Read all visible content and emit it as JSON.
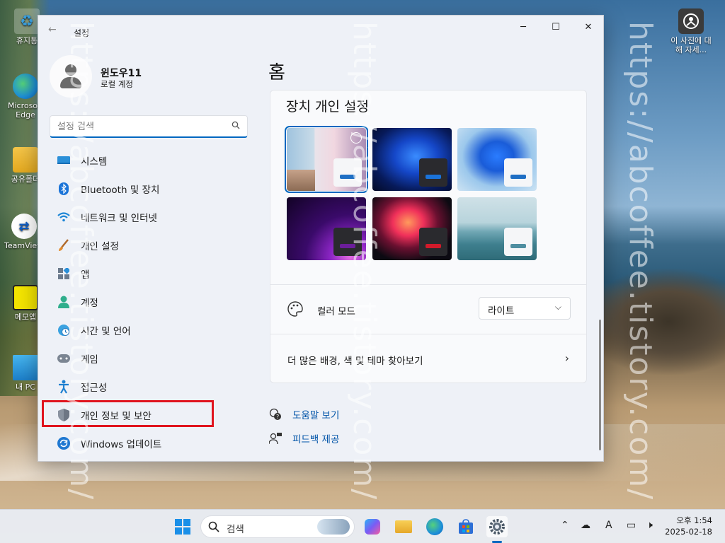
{
  "desktop": {
    "icons": [
      {
        "label": "휴지통"
      },
      {
        "label": "Microsoft Edge"
      },
      {
        "label": "공유폴더"
      },
      {
        "label": "TeamViewer"
      },
      {
        "label": "메모앱"
      },
      {
        "label": "내 PC"
      }
    ],
    "photo_info": {
      "label": "이 사진에 대해 자세..."
    }
  },
  "window": {
    "title": "설정",
    "controls": {
      "minimize": "─",
      "maximize": "☐",
      "close": "✕"
    },
    "profile": {
      "name": "윈도우11",
      "account_type": "로컬 계정"
    },
    "search": {
      "placeholder": "설정 검색"
    },
    "nav": [
      {
        "label": "시스템",
        "icon": "system-icon"
      },
      {
        "label": "Bluetooth 및 장치",
        "icon": "bluetooth-icon"
      },
      {
        "label": "네트워크 및 인터넷",
        "icon": "wifi-icon"
      },
      {
        "label": "개인 설정",
        "icon": "brush-icon"
      },
      {
        "label": "앱",
        "icon": "apps-icon"
      },
      {
        "label": "계정",
        "icon": "account-icon"
      },
      {
        "label": "시간 및 언어",
        "icon": "clock-globe-icon"
      },
      {
        "label": "게임",
        "icon": "gamepad-icon"
      },
      {
        "label": "접근성",
        "icon": "accessibility-icon"
      },
      {
        "label": "개인 정보 및 보안",
        "icon": "shield-icon"
      },
      {
        "label": "Windows 업데이트",
        "icon": "update-icon"
      }
    ],
    "highlighted_item": "개인 정보 및 보안",
    "main": {
      "page_title": "홈",
      "card_title": "장치 개인 설정",
      "themes": [
        {
          "name": "theme-spring",
          "selected": true,
          "accent": "#1f6fc4"
        },
        {
          "name": "theme-bloom-dark",
          "selected": false,
          "accent": "#1a73d9"
        },
        {
          "name": "theme-bloom-light",
          "selected": false,
          "accent": "#1f6fc4"
        },
        {
          "name": "theme-glow",
          "selected": false,
          "accent": "#6b1e9a"
        },
        {
          "name": "theme-flow",
          "selected": false,
          "accent": "#d11a2a"
        },
        {
          "name": "theme-sea",
          "selected": false,
          "accent": "#4e8ea0"
        }
      ],
      "color_mode": {
        "label": "컬러 모드",
        "value": "라이트"
      },
      "more_link": "더 많은 배경, 색 및 테마 찾아보기",
      "help_link": "도움말 보기",
      "feedback_link": "피드백 제공"
    }
  },
  "watermark": "https://abcoffee.tistory.com/",
  "taskbar": {
    "search_label": "검색",
    "clock": {
      "time": "오후 1:54",
      "date": "2025-02-18"
    },
    "ime": "A"
  },
  "colors": {
    "accent": "#0067c0",
    "highlight_box": "#e0141e"
  }
}
